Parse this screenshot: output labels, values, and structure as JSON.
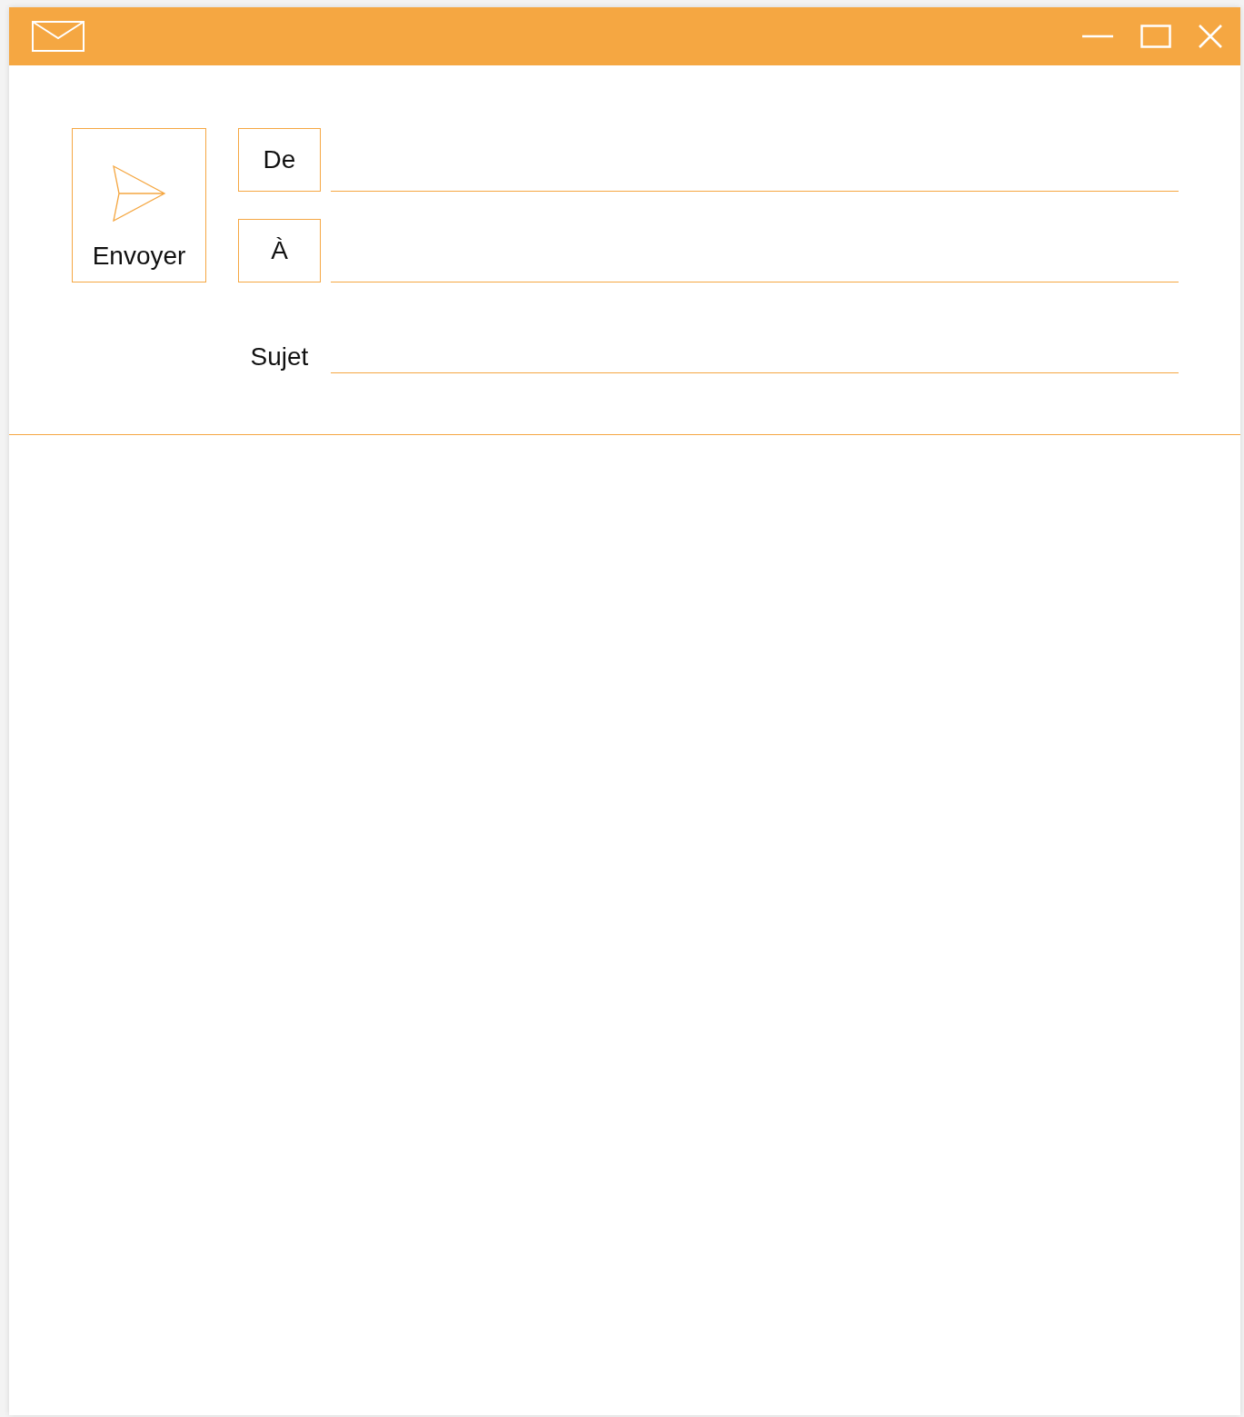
{
  "send_button": {
    "label": "Envoyer"
  },
  "fields": [
    {
      "label": "De",
      "kind": "boxed"
    },
    {
      "label": "À",
      "kind": "boxed"
    },
    {
      "label": "Sujet",
      "kind": "plain"
    }
  ]
}
